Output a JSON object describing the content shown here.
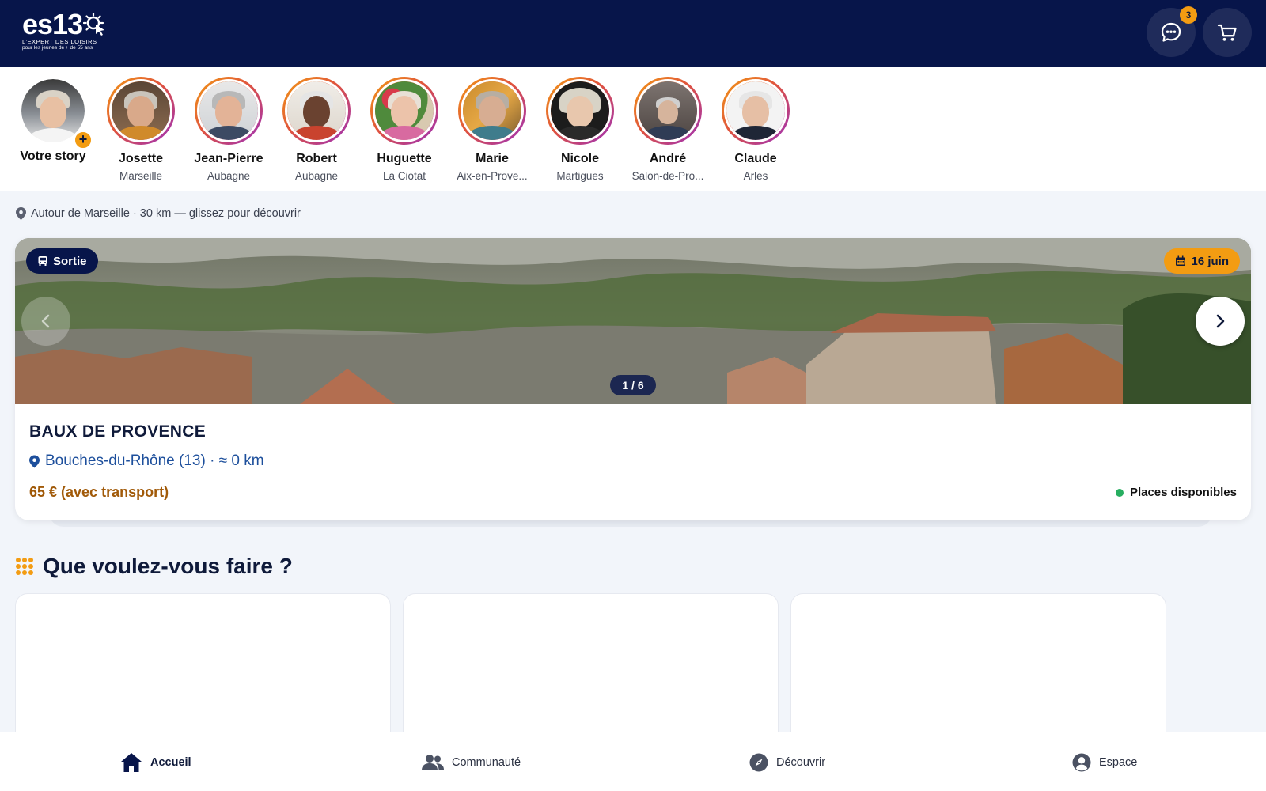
{
  "header": {
    "logo_text": "es13",
    "logo_tagline": "L'EXPERT DES LOISIRS",
    "logo_subtitle": "pour les jeunes de + de 55 ans",
    "messages_badge": "3",
    "bg_color": "#07154a"
  },
  "stories": {
    "own": {
      "label": "Votre story"
    },
    "items": [
      {
        "name": "Josette",
        "city": "Marseille"
      },
      {
        "name": "Jean-Pierre",
        "city": "Aubagne"
      },
      {
        "name": "Robert",
        "city": "Aubagne"
      },
      {
        "name": "Huguette",
        "city": "La Ciotat"
      },
      {
        "name": "Marie",
        "city": "Aix-en-Prove..."
      },
      {
        "name": "Nicole",
        "city": "Martigues"
      },
      {
        "name": "André",
        "city": "Salon-de-Pro..."
      },
      {
        "name": "Claude",
        "city": "Arles"
      }
    ]
  },
  "location": {
    "text": "Autour de Marseille · 30 km — glissez pour découvrir"
  },
  "featured": {
    "type_label": "Sortie",
    "date_label": "16 juin",
    "counter": "1 / 6",
    "title": "BAUX DE PROVENCE",
    "department": "Bouches-du-Rhône (13) · ≈ 0 km",
    "price": "65 € (avec transport)",
    "availability": "Places disponibles",
    "availability_color": "#27ae60"
  },
  "section": {
    "title": "Que voulez-vous faire ?"
  },
  "bottom_nav": {
    "home": "Accueil",
    "community": "Communauté",
    "discover": "Découvrir",
    "space": "Espace"
  },
  "colors": {
    "accent": "#f39c12",
    "navy": "#07154a",
    "link": "#1d4f9c"
  }
}
